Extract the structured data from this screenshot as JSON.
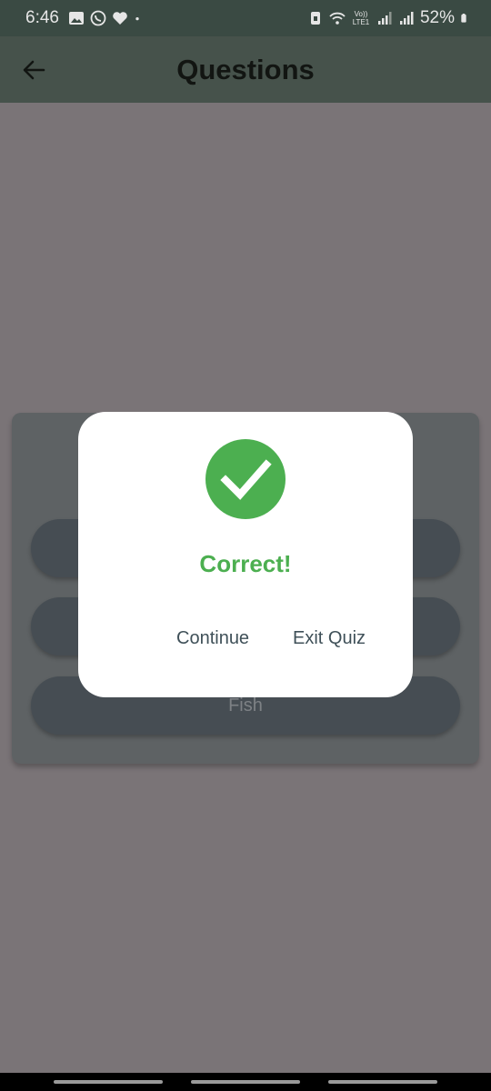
{
  "status_bar": {
    "time": "6:46",
    "battery": "52%",
    "volte": "Vo)) LTE1",
    "icons": [
      "gallery-icon",
      "whatsapp-icon",
      "heart-icon",
      "dot-icon",
      "sim-icon",
      "wifi-icon",
      "signal-icon",
      "signal-icon-2",
      "battery-icon"
    ]
  },
  "app_bar": {
    "title": "Questions",
    "back_icon": "arrow-left-icon"
  },
  "quiz": {
    "visible_option": "Fish"
  },
  "dialog": {
    "icon": "check-circle-icon",
    "message": "Correct!",
    "continue_label": "Continue",
    "exit_label": "Exit Quiz"
  },
  "colors": {
    "success": "#4caf50",
    "app_bar": "#46524b",
    "overlay": "#7a7477"
  }
}
